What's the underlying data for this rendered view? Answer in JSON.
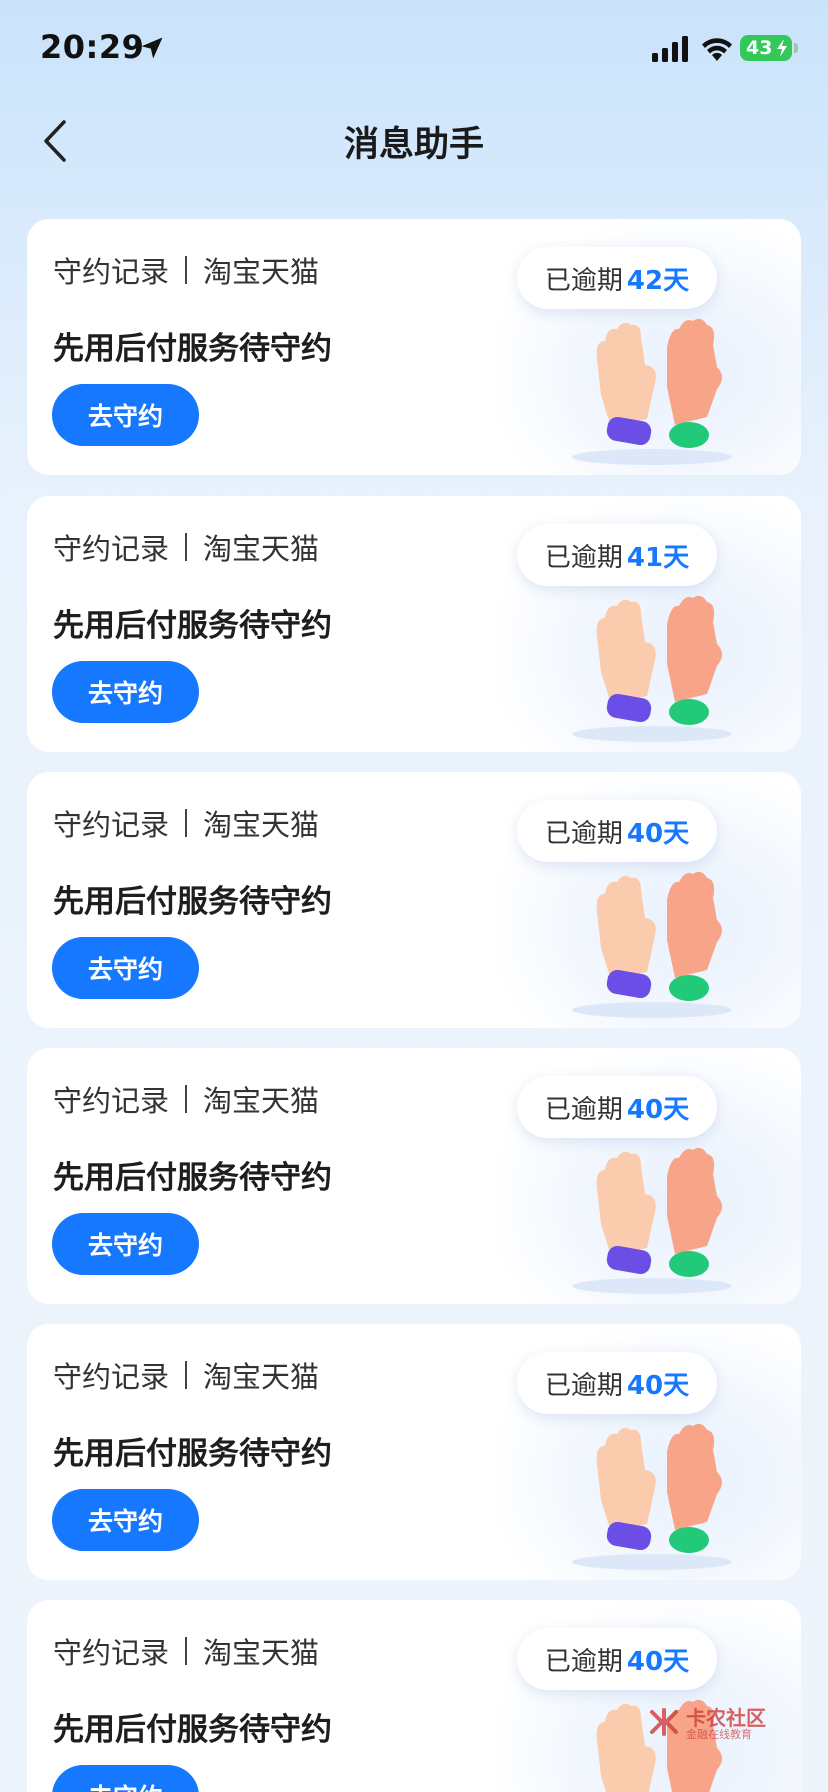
{
  "status_bar": {
    "time": "20:29",
    "battery": "43",
    "location_icon": "location-arrow-icon",
    "signal_icon": "cellular-signal-icon",
    "wifi_icon": "wifi-icon",
    "battery_icon": "battery-charging-icon"
  },
  "nav": {
    "title": "消息助手",
    "back_icon": "chevron-left-icon"
  },
  "cards": [
    {
      "category": "守约记录",
      "source": "淘宝天猫",
      "message": "先用后付服务待守约",
      "button": "去守约",
      "overdue_label": "已逾期",
      "overdue_days": "42天"
    },
    {
      "category": "守约记录",
      "source": "淘宝天猫",
      "message": "先用后付服务待守约",
      "button": "去守约",
      "overdue_label": "已逾期",
      "overdue_days": "41天"
    },
    {
      "category": "守约记录",
      "source": "淘宝天猫",
      "message": "先用后付服务待守约",
      "button": "去守约",
      "overdue_label": "已逾期",
      "overdue_days": "40天"
    },
    {
      "category": "守约记录",
      "source": "淘宝天猫",
      "message": "先用后付服务待守约",
      "button": "去守约",
      "overdue_label": "已逾期",
      "overdue_days": "40天"
    },
    {
      "category": "守约记录",
      "source": "淘宝天猫",
      "message": "先用后付服务待守约",
      "button": "去守约",
      "overdue_label": "已逾期",
      "overdue_days": "40天"
    },
    {
      "category": "守约记录",
      "source": "淘宝天猫",
      "message": "先用后付服务待守约",
      "button": "去守约",
      "overdue_label": "已逾期",
      "overdue_days": "40天"
    }
  ],
  "watermark": {
    "title": "卡农社区",
    "subtitle": "金融在线教育"
  },
  "colors": {
    "accent": "#1677ff",
    "background_top": "#c9e3fb",
    "card": "#ffffff",
    "battery": "#34c759"
  }
}
